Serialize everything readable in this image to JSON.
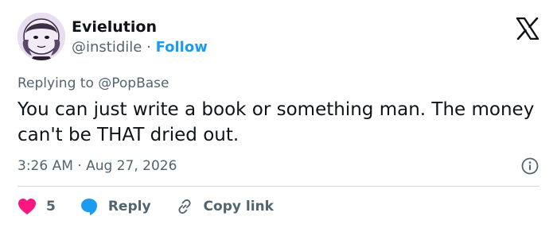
{
  "author": {
    "display_name": "Evielution",
    "handle": "@instidile",
    "separator": "·",
    "follow_label": "Follow"
  },
  "replying": {
    "prefix": "Replying to",
    "mention": "@PopBase"
  },
  "tweet": {
    "text": "You can just write a book or something man. The money can't be THAT dried out.",
    "timestamp": "3:26 AM · Aug 27, 2026"
  },
  "actions": {
    "like_count": "5",
    "reply_label": "Reply",
    "copy_link_label": "Copy link"
  },
  "colors": {
    "accent": "#1d9bf0",
    "like": "#f91880",
    "text": "#0f1419",
    "secondary": "#536471",
    "divider": "#cfd9de"
  }
}
